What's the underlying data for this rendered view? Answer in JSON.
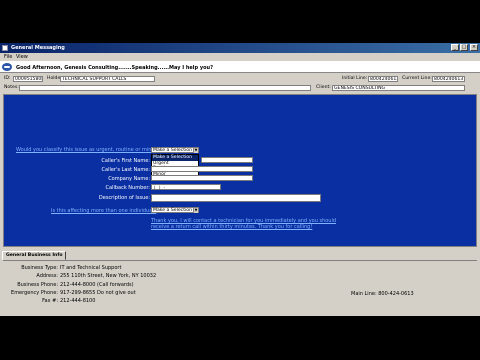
{
  "window": {
    "title": "General Messaging",
    "minimize": "_",
    "maximize": "□",
    "close": "×"
  },
  "menu": [
    {
      "label": "File"
    },
    {
      "label": "View"
    }
  ],
  "welcome": {
    "text": "Good Afternoon, Genesis Consulting.......Speaking......May I help you?"
  },
  "info": {
    "id_label": "ID:",
    "id_value": "0009515808",
    "holder_label": "Holder:",
    "holder_value": "TECHNICAL SUPPORT CALLS",
    "initial_line_label": "Initial Line:",
    "initial_line_value": "8004240613",
    "current_line_label": "Current Line:",
    "current_line_value": "8004240613",
    "notes_label": "Notes:",
    "notes_value": "",
    "client_label": "Client:",
    "client_value": "GENESIS CONSULTING"
  },
  "form": {
    "q_urgent": "Would you classify this issue as urgent, routine or minor?",
    "make_selection": "Make a Selection",
    "dropdown_options": [
      "Make a Selection",
      "Urgent",
      "Routine",
      "Minor"
    ],
    "first_name": "Caller's First Name:",
    "last_name": "Caller's Last Name:",
    "company_name": "Company Name:",
    "callback_number": "Callback Number:",
    "callback_placeholder": "(   )  -",
    "description": "Description of Issue:",
    "q_more_than_one": "Is this affecting more than one individual?",
    "more_selection": "Make a Selection",
    "thank_you": "Thank you, I will contact a technician for you immediately and you should receive a return call within thirty minutes. Thank you for calling!"
  },
  "section_tab": "General Business Info",
  "business": {
    "type_label": "Business Type:",
    "type_value": "IT and Technical Support",
    "address_label": "Address:",
    "address_value": "255 110th Street, New York, NY 10032",
    "phone_label": "Business Phone:",
    "phone_value": "212-444-8000 (Call forwards)",
    "emergency_label": "Emergency Phone:",
    "emergency_value": "917-299-8655 Do not give out",
    "fax_label": "Fax #:",
    "fax_value": "212-444-8100",
    "main_line_label": "Main Line:",
    "main_line_value": "800-424-0613"
  }
}
